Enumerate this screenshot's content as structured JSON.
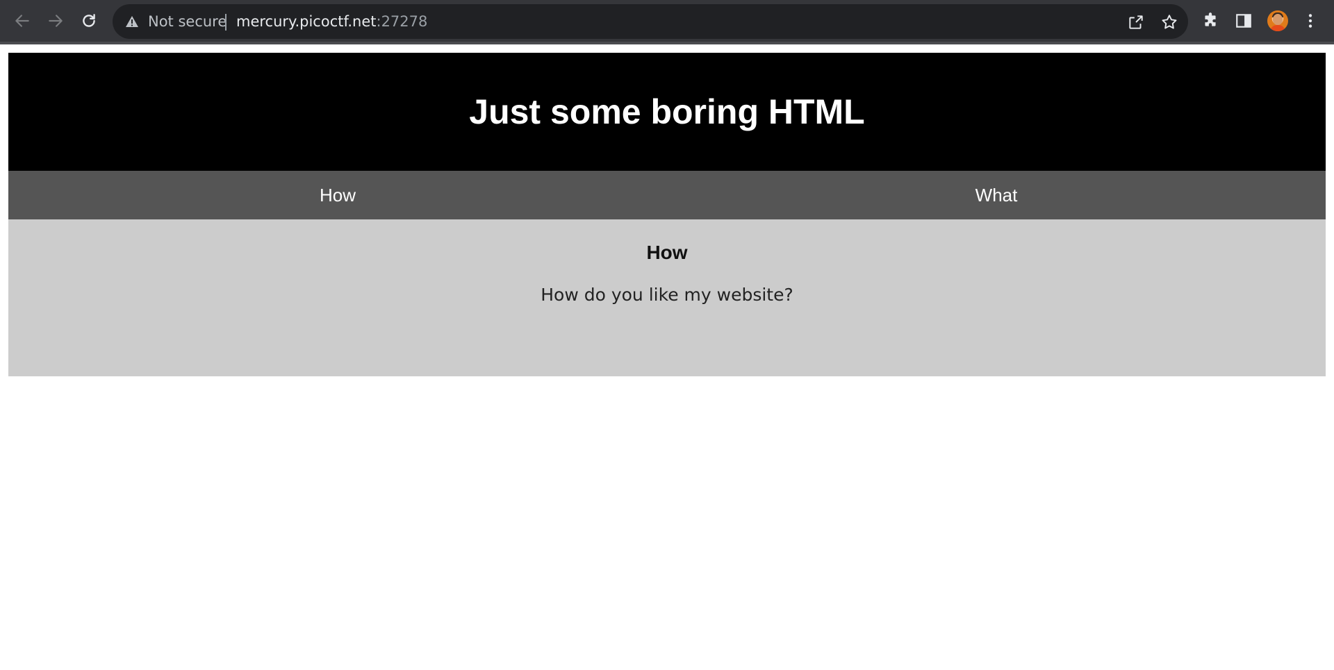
{
  "browser": {
    "security_label": "Not secure",
    "url_host": "mercury.picoctf.net",
    "url_port": ":27278",
    "icons": {
      "back": "arrow-left-icon",
      "forward": "arrow-right-icon",
      "reload": "reload-icon",
      "warning": "warning-icon",
      "share": "share-icon",
      "bookmark": "star-icon",
      "extensions": "puzzle-icon",
      "side_panel": "side-panel-icon",
      "profile": "avatar",
      "menu": "kebab-menu-icon"
    },
    "colors": {
      "toolbar": "#35363a",
      "omnibox": "#202124"
    }
  },
  "page": {
    "title": "Just some boring HTML",
    "tabs": [
      {
        "label": "How"
      },
      {
        "label": "What"
      }
    ],
    "section": {
      "heading": "How",
      "text": "How do you like my website?"
    },
    "colors": {
      "header_bg": "#000000",
      "tabs_bg": "#555555",
      "content_bg": "#cccccc"
    }
  }
}
